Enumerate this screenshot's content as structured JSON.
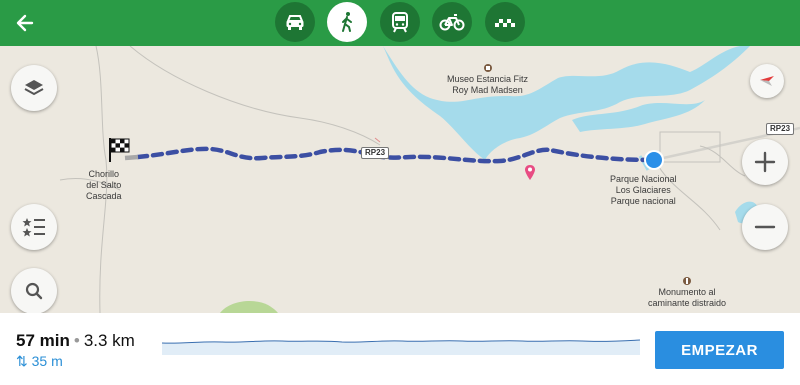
{
  "header": {
    "back_icon": "arrow-left-icon",
    "modes": [
      {
        "name": "car",
        "icon": "car-icon"
      },
      {
        "name": "walk",
        "icon": "pedestrian-icon",
        "active": true
      },
      {
        "name": "transit",
        "icon": "train-icon"
      },
      {
        "name": "bike",
        "icon": "bicycle-icon"
      },
      {
        "name": "taxi",
        "icon": "taxi-icon"
      }
    ],
    "colors": {
      "bar": "#2a9b46",
      "mode_bg": "#1e7634",
      "active_bg": "#ffffff"
    }
  },
  "map": {
    "labels": {
      "museum": "Museo Estancia Fitz\nRoy Mad Madsen",
      "destination": "Chorillo\ndel Salto\nCascada",
      "origin": "Parque Nacional\nLos Glaciares\nParque nacional",
      "monument": "Monumento al\ncaminante distraido",
      "road_1": "RP23",
      "road_2": "RP23"
    },
    "colors": {
      "land": "#ece8df",
      "water": "#a5dbeb",
      "route": "#3c4fa3",
      "origin_dot": "#2b8fe8"
    },
    "controls": [
      "layers-icon",
      "favorites-list-icon",
      "search-icon",
      "compass-icon",
      "zoom-in-icon",
      "zoom-out-icon"
    ]
  },
  "route": {
    "duration": "57 min",
    "separator": "•",
    "distance": "3.3 km",
    "elevation": "35 m",
    "start_label": "EMPEZAR",
    "colors": {
      "elevation_text": "#2b8fd6",
      "button": "#2a8ee0"
    }
  }
}
